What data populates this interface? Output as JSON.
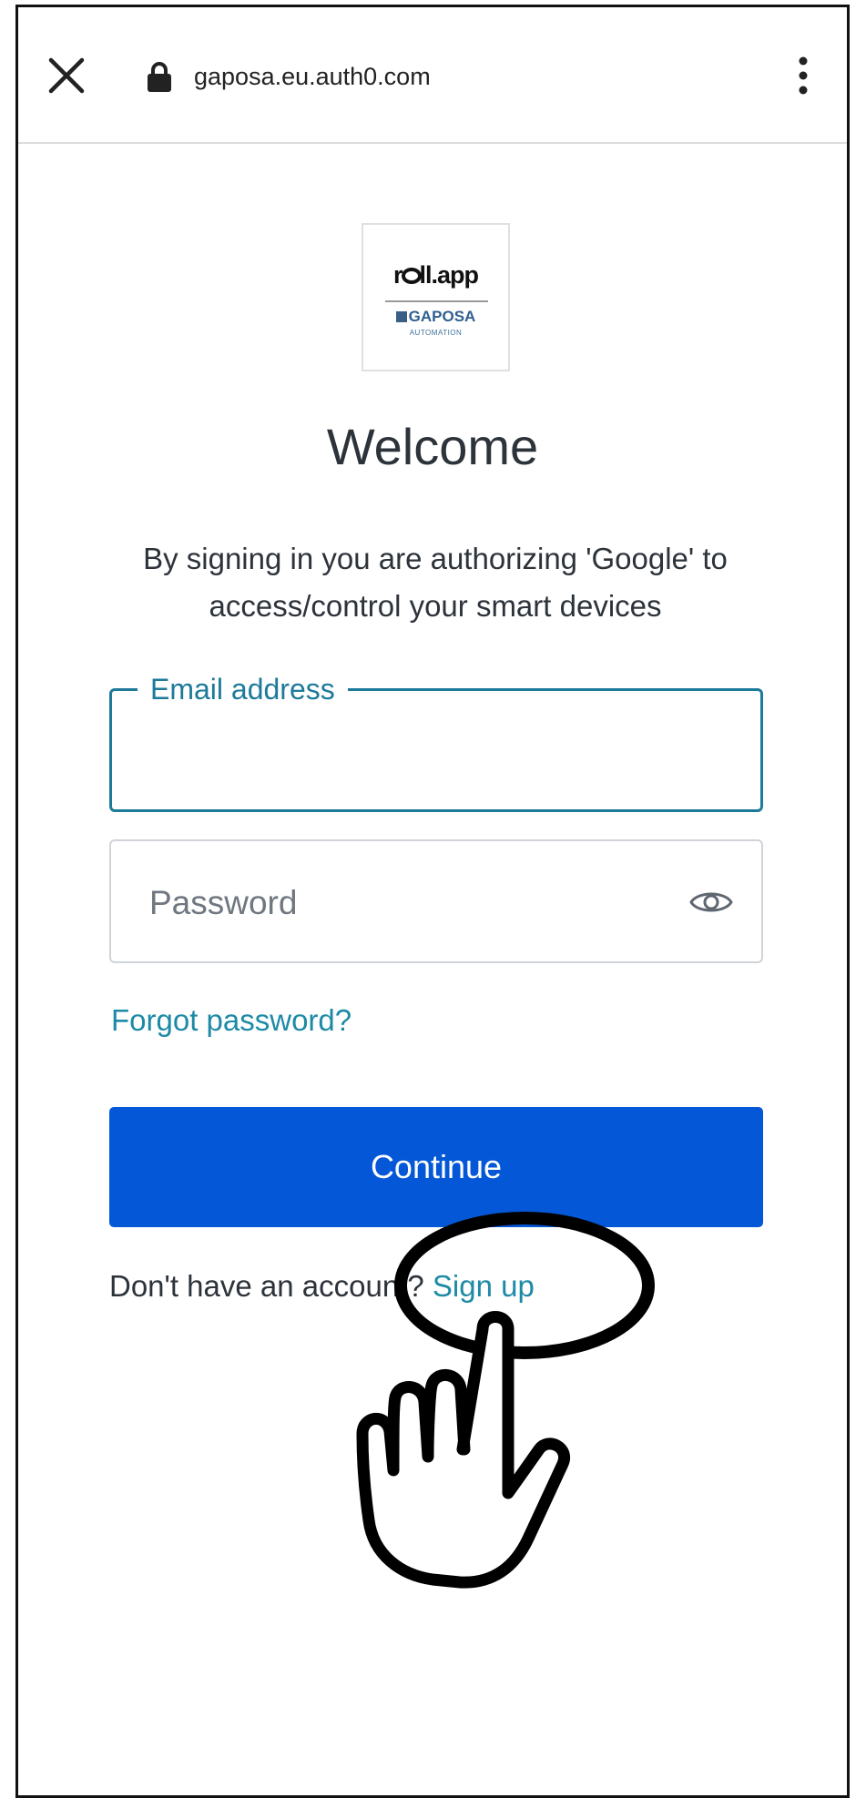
{
  "browser": {
    "url": "gaposa.eu.auth0.com",
    "icons": {
      "close": "close-icon",
      "lock": "lock-icon",
      "menu": "more-vert-icon"
    }
  },
  "logo": {
    "app_name": "r  ll.app",
    "brand": "GAPOSA",
    "tagline": "AUTOMATION"
  },
  "page": {
    "title": "Welcome",
    "subtitle": "By signing in you are authorizing 'Google' to access/control your smart devices"
  },
  "form": {
    "email_label": "Email address",
    "email_value": "",
    "password_placeholder": "Password",
    "password_value": "",
    "forgot_password": "Forgot password?",
    "continue_label": "Continue"
  },
  "signup": {
    "prompt": "Don't have an account?",
    "link": "Sign up"
  },
  "colors": {
    "accent": "#1e7a9a",
    "link": "#1d8aa6",
    "button": "#0457d6",
    "text": "#2d333a"
  }
}
